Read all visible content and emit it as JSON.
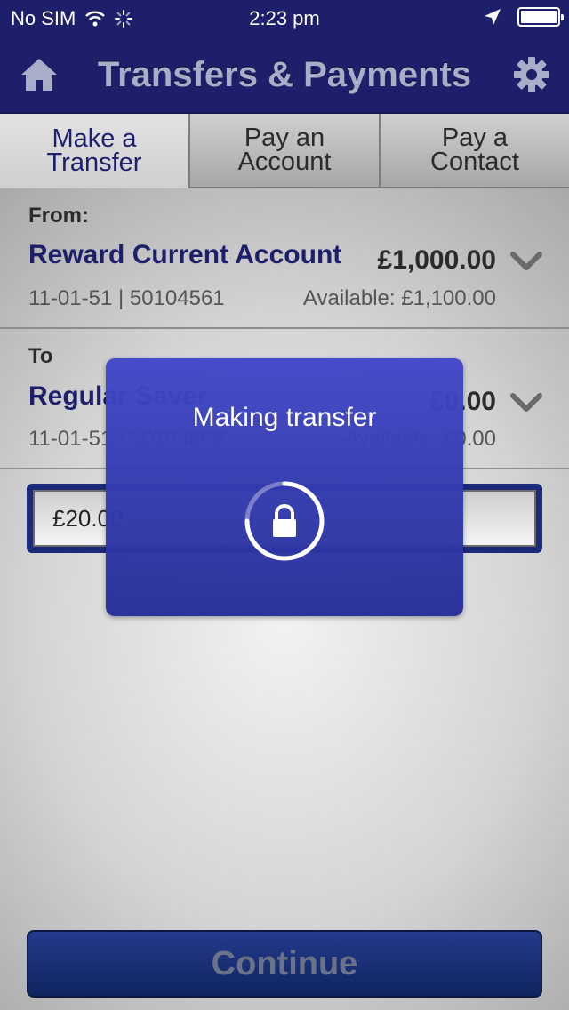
{
  "status_bar": {
    "carrier": "No SIM",
    "time": "2:23 pm",
    "icons": [
      "wifi-icon",
      "activity-spinner-icon",
      "location-arrow-icon",
      "battery-icon"
    ]
  },
  "nav": {
    "title": "Transfers & Payments",
    "home_icon": "home-icon",
    "settings_icon": "gear-icon"
  },
  "tabs": [
    {
      "label": "Make a\nTransfer",
      "active": true
    },
    {
      "label": "Pay an\nAccount",
      "active": false
    },
    {
      "label": "Pay a\nContact",
      "active": false
    }
  ],
  "from": {
    "label": "From:",
    "account_name": "Reward Current Account",
    "balance": "£1,000.00",
    "sort_account": "11-01-51 | 50104561",
    "available": "Available: £1,100.00"
  },
  "to": {
    "label": "To",
    "account_name": "Regular Saver",
    "balance": "£0.00",
    "sort_account": "11-01-51 | 50104868",
    "available": "Available: £0.00"
  },
  "amount": {
    "value": "£20.00"
  },
  "continue_label": "Continue",
  "modal": {
    "title": "Making transfer",
    "icon": "lock-icon"
  },
  "colors": {
    "brand_navy": "#1d1f6b",
    "modal_blue": "#3f46c4",
    "account_name": "#1d1f6b"
  }
}
